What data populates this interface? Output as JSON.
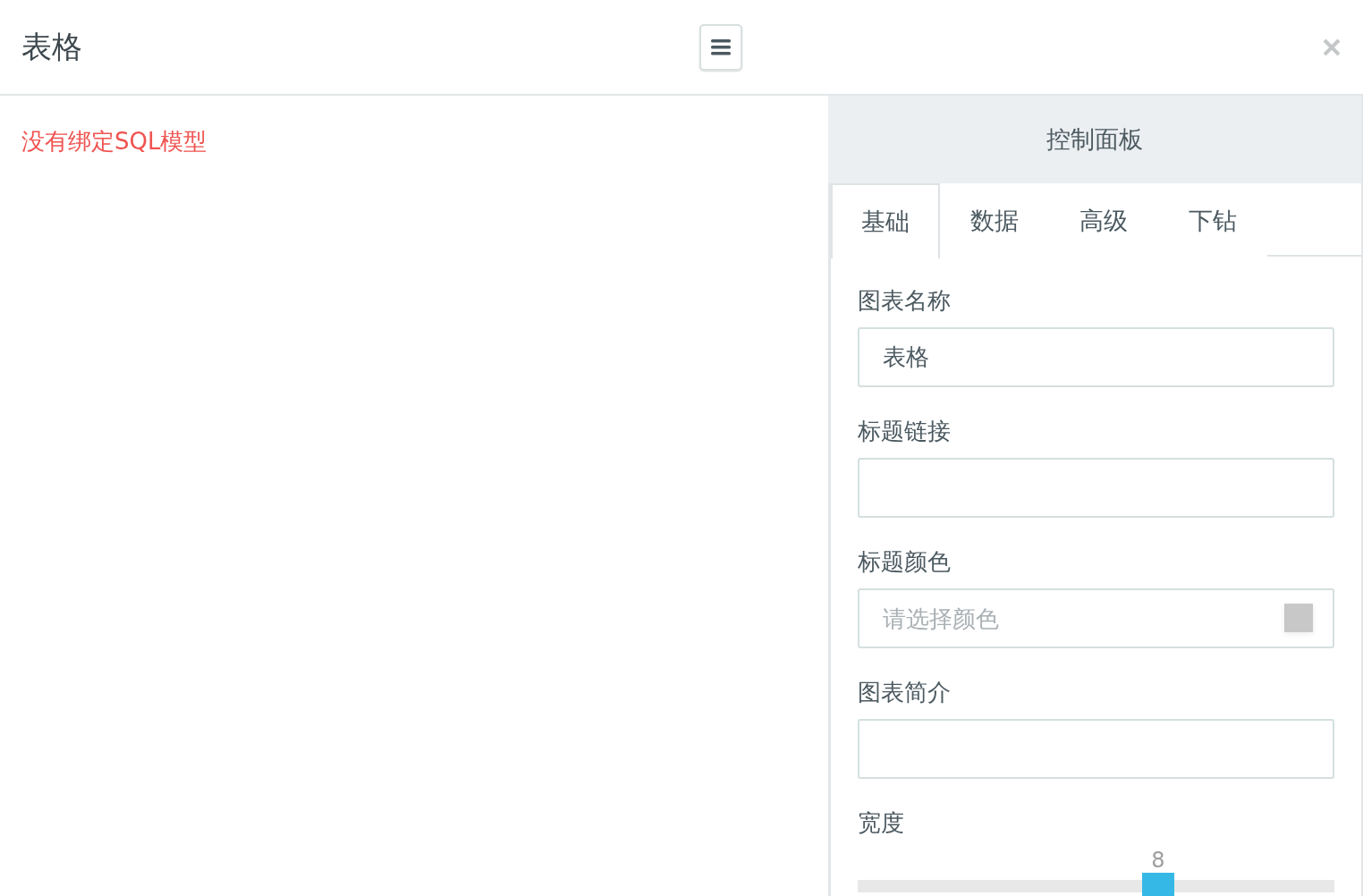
{
  "header": {
    "title": "表格"
  },
  "message": "没有绑定SQL模型",
  "panel": {
    "title": "控制面板",
    "tabs": [
      {
        "label": "基础",
        "selected": true
      },
      {
        "label": "数据",
        "selected": false
      },
      {
        "label": "高级",
        "selected": false
      },
      {
        "label": "下钻",
        "selected": false
      }
    ],
    "fields": [
      {
        "kind": "text",
        "label": "图表名称",
        "value": "表格"
      },
      {
        "kind": "text",
        "label": "标题链接"
      },
      {
        "kind": "color",
        "label": "标题颜色",
        "placeholder": "请选择颜色",
        "color": "#c8c8c8"
      },
      {
        "kind": "text",
        "label": "图表简介"
      },
      {
        "kind": "slider",
        "label": "宽度",
        "reading": "8",
        "level": 0.63
      }
    ]
  }
}
